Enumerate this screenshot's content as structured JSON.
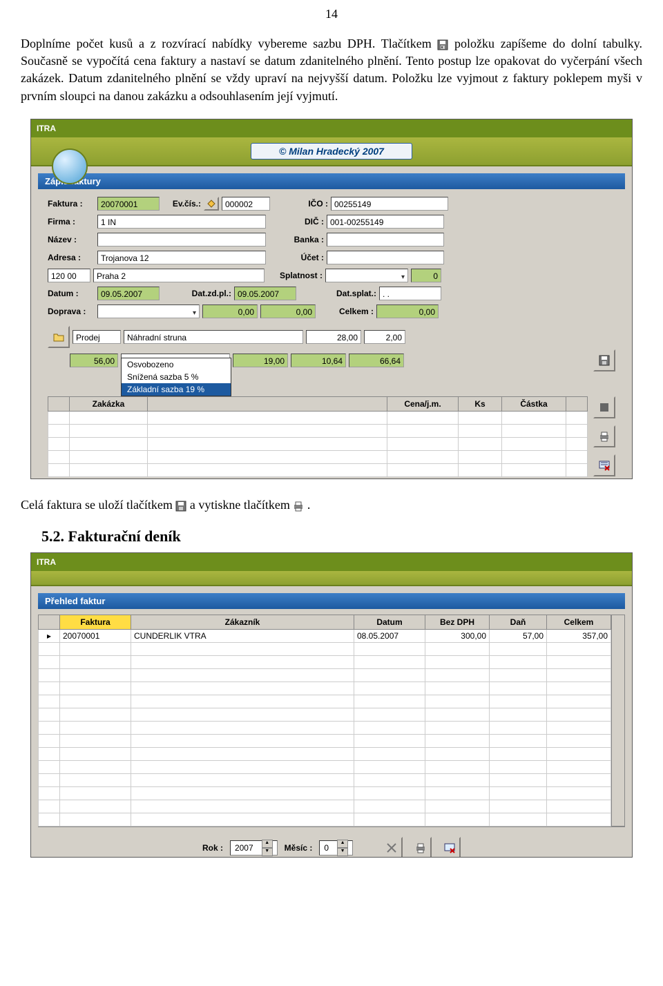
{
  "page_number": "14",
  "para1a": "Doplníme počet kusů a z rozvírací nabídky vybereme sazbu DPH. Tlačítkem ",
  "para1b": " položku zapíšeme do dolní tabulky. Současně se vypočítá cena faktury a nastaví se datum zdanitelného plnění. Tento postup lze opakovat do vyčerpání všech zakázek. Datum zdanitelného plnění se vždy upraví na nejvyšší datum. Položku lze vyjmout z faktury poklepem myši v prvním sloupci na danou zakázku a odsouhlasením její vyjmutí.",
  "para2a": "Celá faktura se uloží tlačítkem ",
  "para2b": " a vytiskne tlačítkem ",
  "para2c": " .",
  "section_heading": "5.2. Fakturační deník",
  "win1": {
    "app_title": "ITRA",
    "header_caption": "© Milan Hradecký  2007",
    "panel_title": "Zápis faktury",
    "labels": {
      "faktura": "Faktura :",
      "evcis": "Ev.čís.:",
      "ico": "IČO :",
      "firma": "Firma :",
      "dic": "DIČ :",
      "nazev": "Název :",
      "banka": "Banka :",
      "adresa": "Adresa :",
      "ucet": "Účet :",
      "splatnost": "Splatnost :",
      "datum": "Datum :",
      "datzdpl": "Dat.zd.pl.:",
      "datsplat": "Dat.splat.:",
      "doprava": "Doprava :",
      "celkem": "Celkem :"
    },
    "values": {
      "faktura": "20070001",
      "evcis": "000002",
      "ico": "00255149",
      "firma": "1 IN",
      "dic": "001-00255149",
      "nazev": "",
      "banka": "",
      "adresa1": "Trojanova 12",
      "ucet": "",
      "adresa_psc": "120 00",
      "adresa2": "Praha 2",
      "splatnost_dd": "",
      "splatnost_num": "0",
      "datum": "09.05.2007",
      "datzdpl": "09.05.2007",
      "datsplat": ". .",
      "doprava": "",
      "doprava_a": "0,00",
      "doprava_b": "0,00",
      "celkem": "0,00",
      "prodej": "Prodej",
      "nahradni": "Náhradní struna",
      "item_qty": "28,00",
      "item_cnt": "2,00",
      "item_sum": "56,00",
      "vat_sel": "Základní sazba 19 %",
      "col_a": "19,00",
      "col_b": "10,64",
      "col_c": "66,64"
    },
    "vat_options": [
      "Osvobozeno",
      "Snížená sazba 5 %",
      "Základní sazba 19 %"
    ],
    "grid_headers": [
      "Zakázka",
      "",
      "Cena/j.m.",
      "Ks",
      "Částka"
    ]
  },
  "win2": {
    "app_title": "ITRA",
    "panel_title": "Přehled faktur",
    "headers": [
      "Faktura",
      "Zákazník",
      "Datum",
      "Bez DPH",
      "Daň",
      "Celkem"
    ],
    "row": {
      "faktura": "20070001",
      "zakaznik": "CUNDERLIK VTRA",
      "datum": "08.05.2007",
      "bezdph": "300,00",
      "dan": "57,00",
      "celkem": "357,00"
    },
    "footer": {
      "rok_label": "Rok :",
      "rok_val": "2007",
      "mesic_label": "Měsíc :",
      "mesic_val": "0"
    }
  }
}
